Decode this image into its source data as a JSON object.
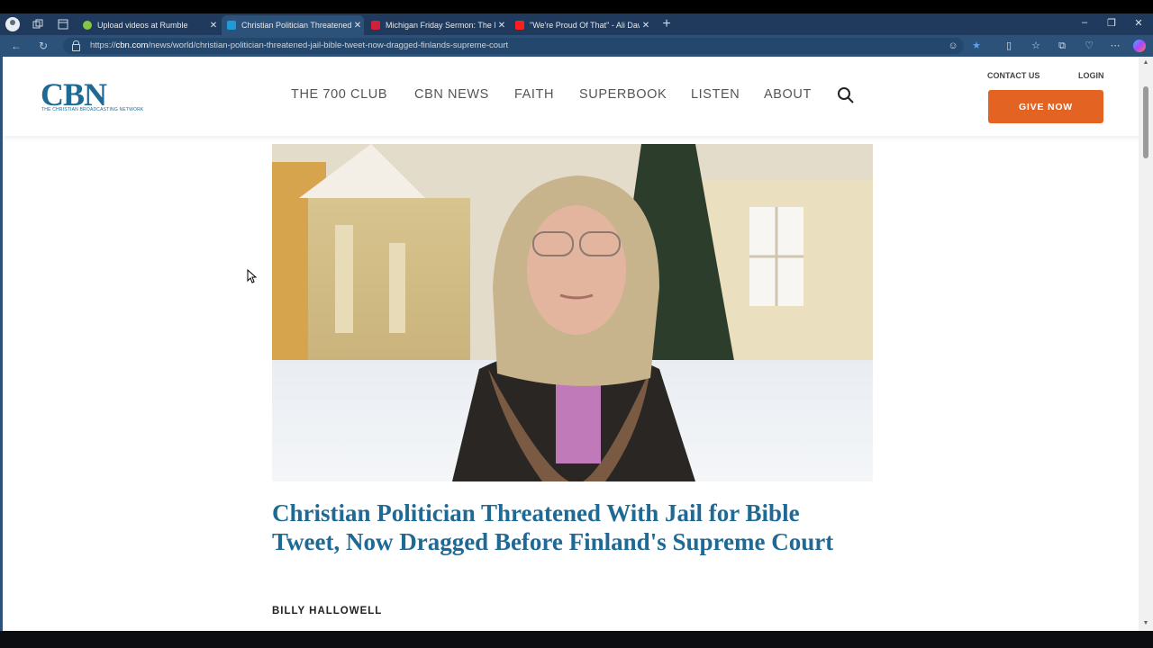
{
  "browser": {
    "tabs": [
      {
        "title": "Upload videos at Rumble",
        "favicon_color": "#85c742",
        "active": false
      },
      {
        "title": "Christian Politician Threatened Wi",
        "favicon_color": "#1f9bd7",
        "active": true
      },
      {
        "title": "Michigan Friday Sermon: The Mu",
        "favicon_color": "#d0203a",
        "active": false
      },
      {
        "title": "\"We're Proud Of That\" - Ali Dawah",
        "favicon_color": "#ff1e1e",
        "active": false
      }
    ],
    "url_prefix": "https://",
    "url_host": "cbn.com",
    "url_path": "/news/world/christian-politician-threatened-jail-bible-tweet-now-dragged-finlands-supreme-court"
  },
  "site": {
    "logo": "CBN",
    "logo_sub": "THE CHRISTIAN BROADCASTING NETWORK",
    "nav": [
      "THE 700 CLUB",
      "CBN NEWS",
      "FAITH",
      "SUPERBOOK",
      "LISTEN",
      "ABOUT"
    ],
    "contact": "CONTACT US",
    "login": "LOGIN",
    "give": "GIVE NOW"
  },
  "article": {
    "title": "Christian Politician Threatened With Jail for Bible Tweet, Now Dragged Before Finland's Supreme Court",
    "author": "BILLY HALLOWELL"
  },
  "colors": {
    "brand": "#1f6a95",
    "give_button": "#e36323",
    "tabbar": "#1f3a5c",
    "addrbar": "#2c527a"
  }
}
